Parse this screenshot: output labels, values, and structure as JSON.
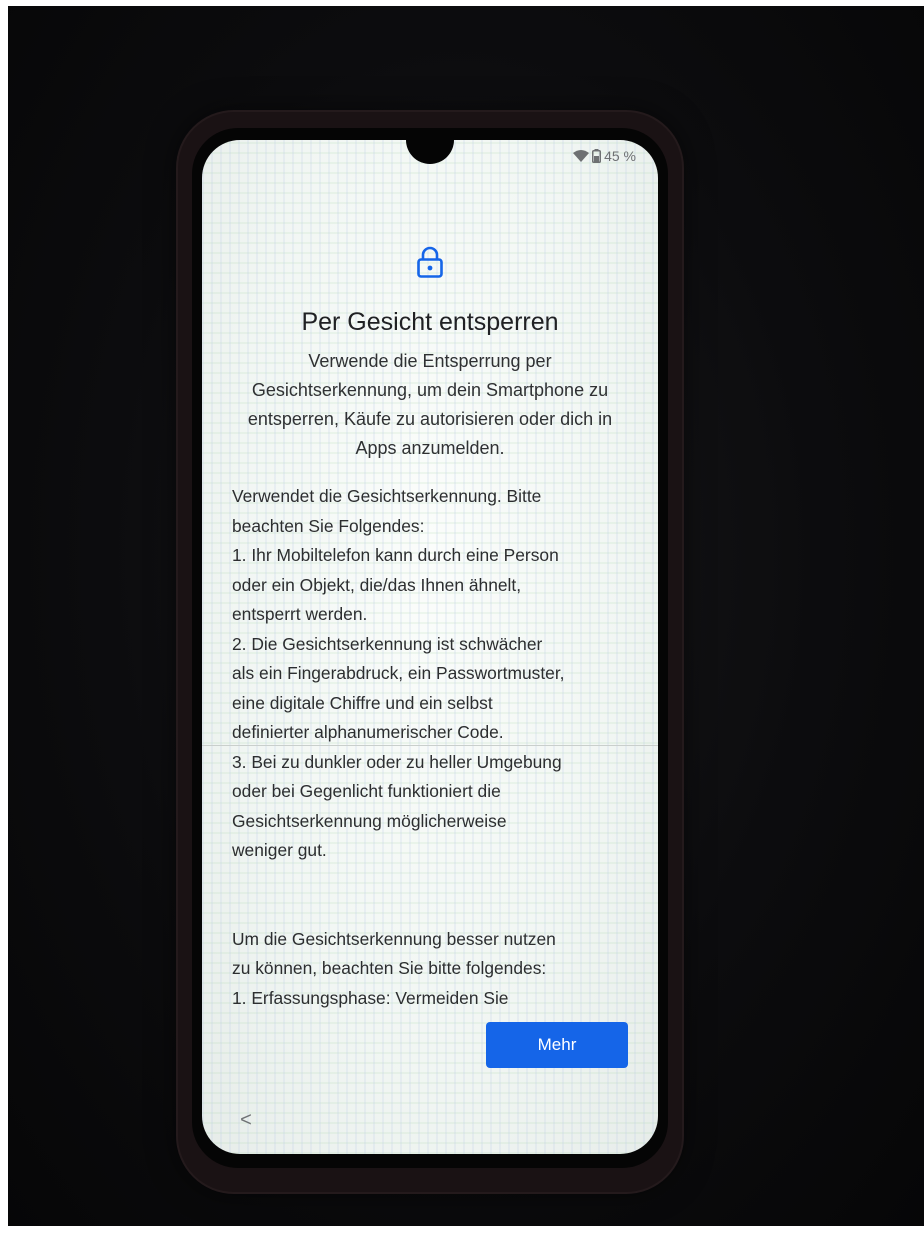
{
  "status_bar": {
    "battery_level": "45 %",
    "icons": [
      "wifi-icon",
      "battery-icon"
    ]
  },
  "header": {
    "icon": "lock-icon",
    "title": "Per Gesicht entsperren",
    "subtitle": "Verwende die Entsperrung per Gesichtserkennung, um dein Smartphone zu entsperren, Käufe zu autorisieren oder dich in Apps anzumelden."
  },
  "content": {
    "intro_lines": [
      "Verwendet die Gesichtserkennung. Bitte",
      "beachten Sie Folgendes:"
    ],
    "notes_lines": [
      "1. Ihr Mobiltelefon kann durch eine Person",
      "oder ein Objekt, die/das Ihnen ähnelt,",
      "entsperrt werden.",
      "2. Die Gesichtserkennung ist schwächer",
      "als ein Fingerabdruck, ein Passwortmuster,",
      "eine digitale Chiffre und ein selbst",
      "definierter alphanumerischer Code.",
      "3. Bei zu dunkler oder zu heller Umgebung",
      "oder bei Gegenlicht funktioniert die",
      "Gesichtserkennung möglicherweise",
      "weniger gut."
    ],
    "tips_lines": [
      "Um die Gesichtserkennung besser nutzen",
      "zu können, beachten Sie bitte folgendes:",
      "1. Erfassungsphase: Vermeiden Sie"
    ]
  },
  "footer": {
    "more_label": "Mehr",
    "back_label": "<"
  },
  "colors": {
    "accent": "#1565e8",
    "text": "#2c2e30",
    "status": "#6e7073"
  }
}
